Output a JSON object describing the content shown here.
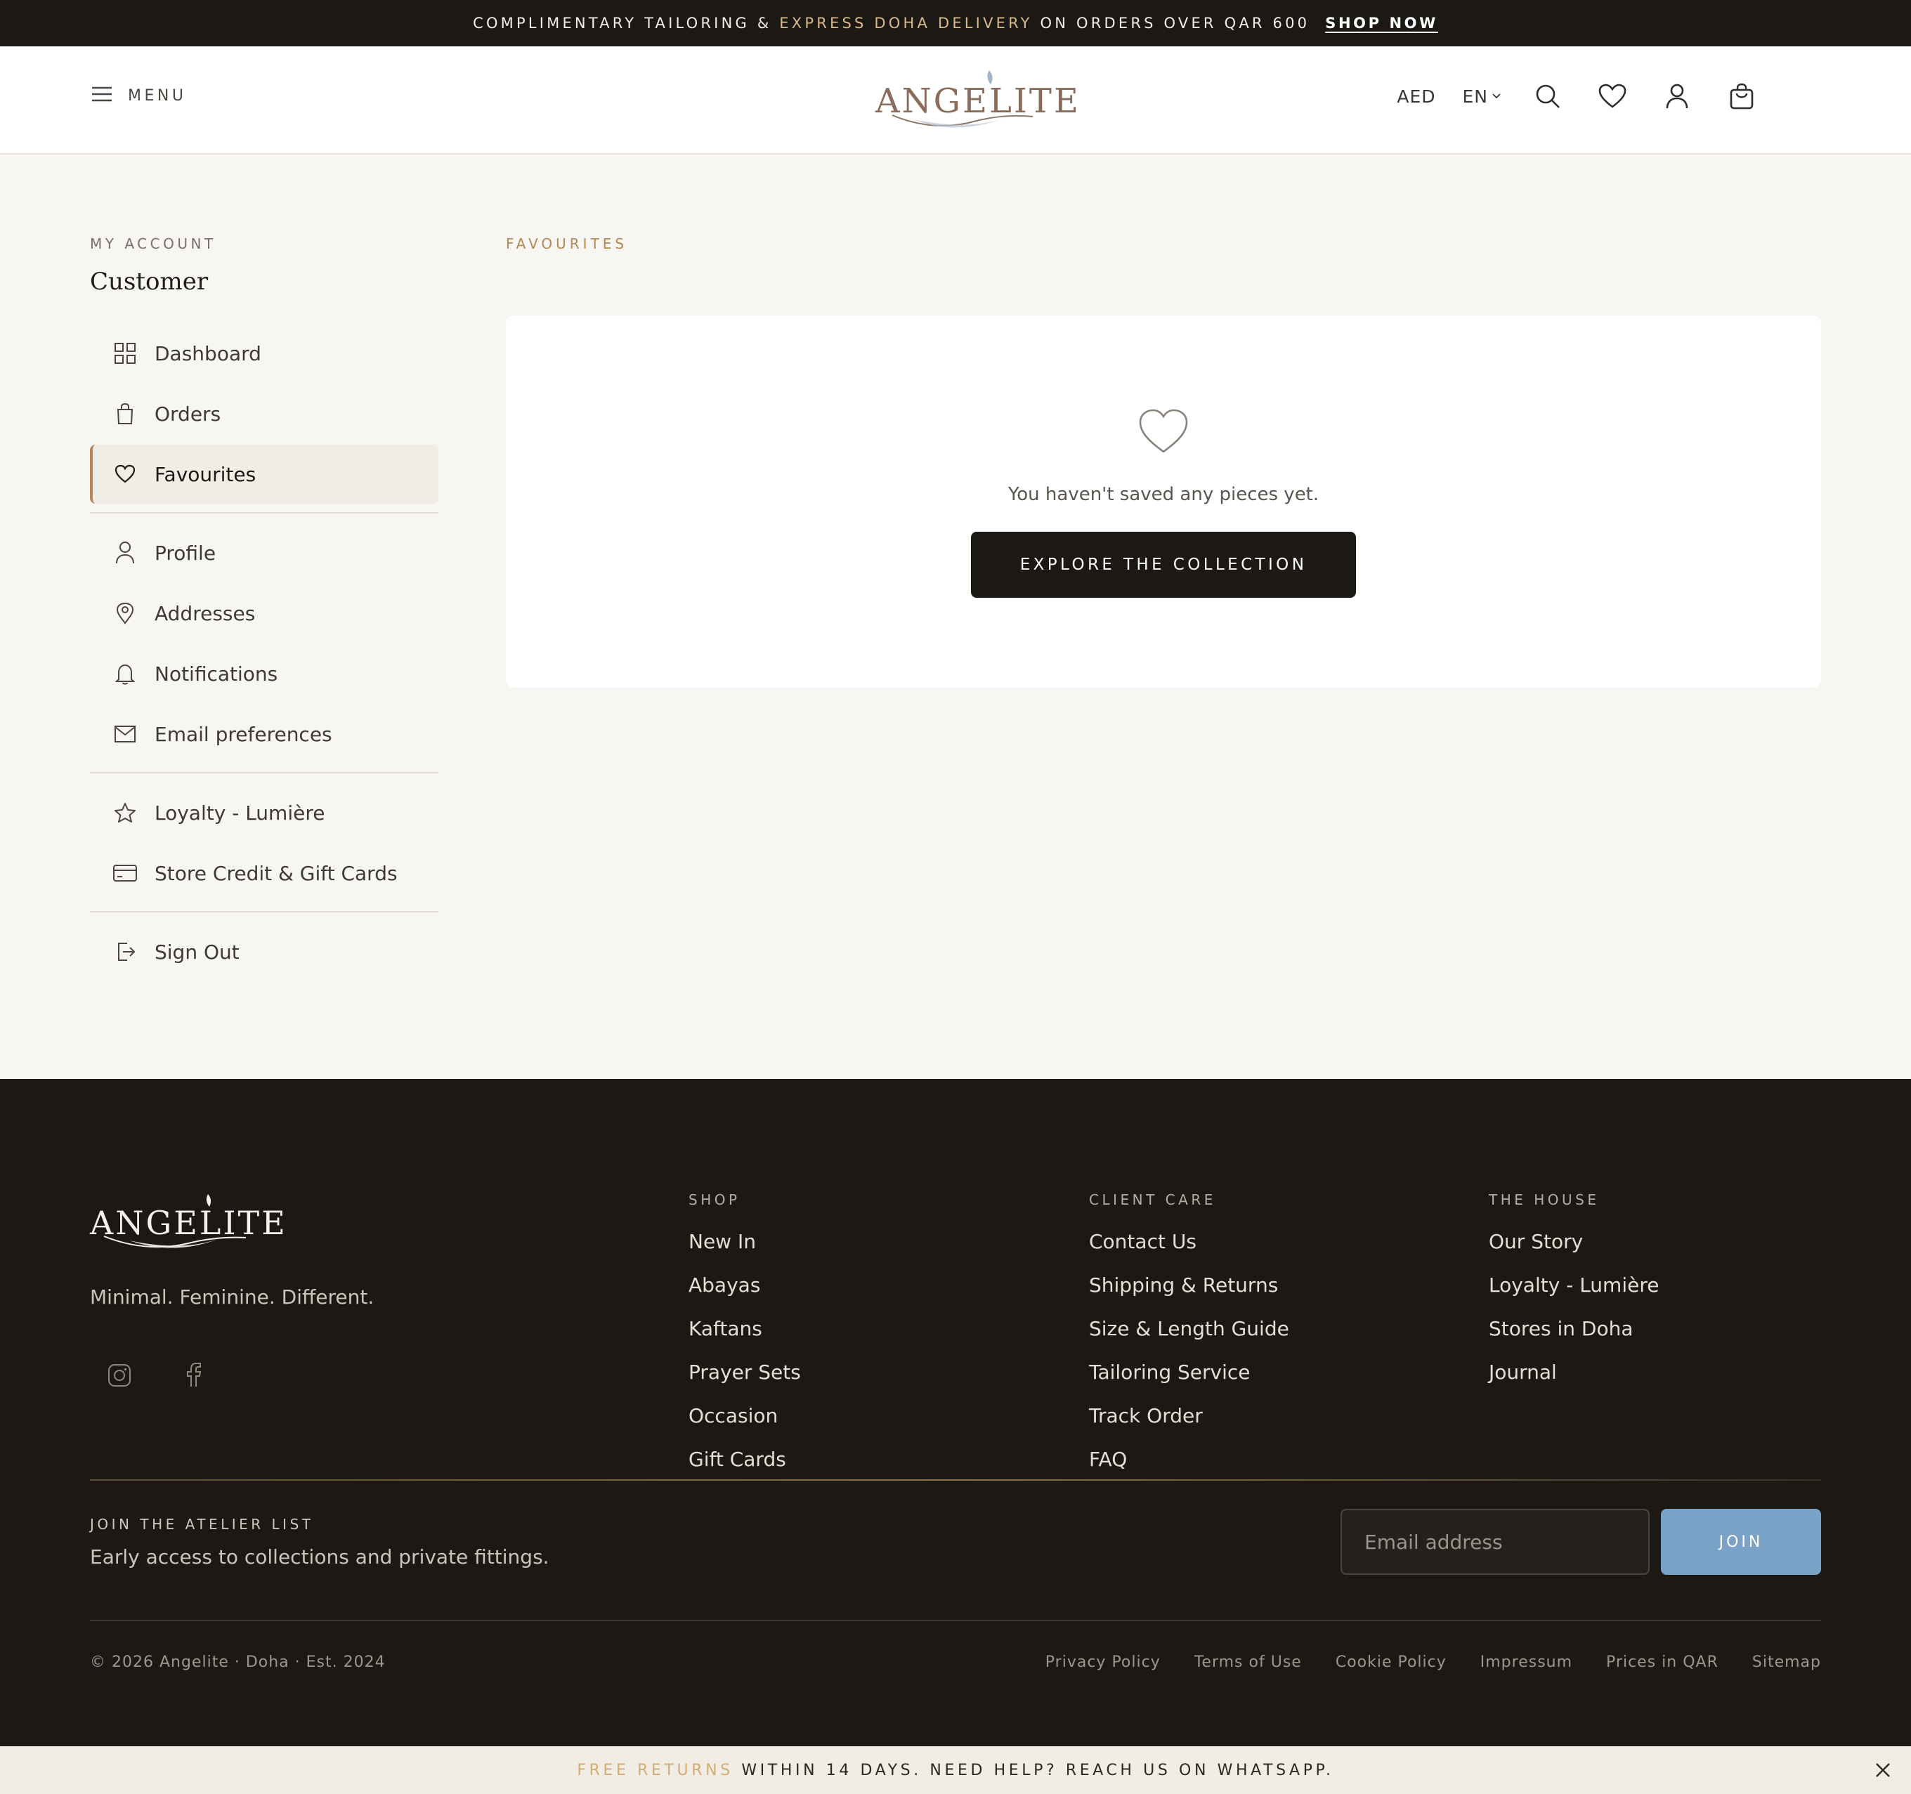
{
  "promo_top": {
    "text_before": "COMPLIMENTARY TAILORING & ",
    "accent": "EXPRESS DOHA DELIVERY",
    "text_after": " ON ORDERS OVER QAR 600",
    "link": "SHOP NOW"
  },
  "header": {
    "menu_label": "MENU",
    "logo": "ANGELITE",
    "currency": "AED",
    "language": "EN",
    "icons": [
      "search-icon",
      "heart-icon",
      "user-icon",
      "bag-icon"
    ]
  },
  "sidebar": {
    "section_label": "MY ACCOUNT",
    "customer_name": "Customer",
    "groups": [
      [
        {
          "label": "Dashboard",
          "icon": "grid-icon"
        },
        {
          "label": "Orders",
          "icon": "bag-icon"
        },
        {
          "label": "Favourites",
          "icon": "heart-icon",
          "active": true
        }
      ],
      [
        {
          "label": "Profile",
          "icon": "user-icon"
        },
        {
          "label": "Addresses",
          "icon": "map-pin-icon"
        },
        {
          "label": "Notifications",
          "icon": "bell-icon"
        },
        {
          "label": "Email preferences",
          "icon": "mail-icon"
        }
      ],
      [
        {
          "label": "Loyalty - Lumière",
          "icon": "star-icon"
        },
        {
          "label": "Store Credit & Gift Cards",
          "icon": "credit-card-icon"
        }
      ],
      [
        {
          "label": "Sign Out",
          "icon": "sign-out-icon"
        }
      ]
    ]
  },
  "main": {
    "section_label": "FAVOURITES",
    "empty_text": "You haven't saved any pieces yet.",
    "cta": "EXPLORE THE COLLECTION"
  },
  "footer": {
    "logo": "ANGELITE",
    "tagline": "Minimal. Feminine. Different.",
    "socials": [
      "instagram-icon",
      "facebook-icon"
    ],
    "columns": [
      {
        "title": "SHOP",
        "links": [
          "New In",
          "Abayas",
          "Kaftans",
          "Prayer Sets",
          "Occasion",
          "Gift Cards"
        ]
      },
      {
        "title": "CLIENT CARE",
        "links": [
          "Contact Us",
          "Shipping & Returns",
          "Size & Length Guide",
          "Tailoring Service",
          "Track Order",
          "FAQ"
        ]
      },
      {
        "title": "THE HOUSE",
        "links": [
          "Our Story",
          "Loyalty - Lumière",
          "Stores in Doha",
          "Journal"
        ]
      }
    ],
    "newsletter": {
      "title": "JOIN THE ATELIER LIST",
      "subtitle": "Early access to collections and private fittings.",
      "placeholder": "Email address",
      "button": "JOIN"
    },
    "copyright": "© 2026 Angelite · Doha · Est. 2024",
    "legal": [
      "Privacy Policy",
      "Terms of Use",
      "Cookie Policy",
      "Impressum",
      "Prices in QAR",
      "Sitemap"
    ]
  },
  "promo_bottom": {
    "accent": "FREE RETURNS",
    "text": " WITHIN 14 DAYS. NEED HELP? REACH US ON WHATSAPP."
  }
}
